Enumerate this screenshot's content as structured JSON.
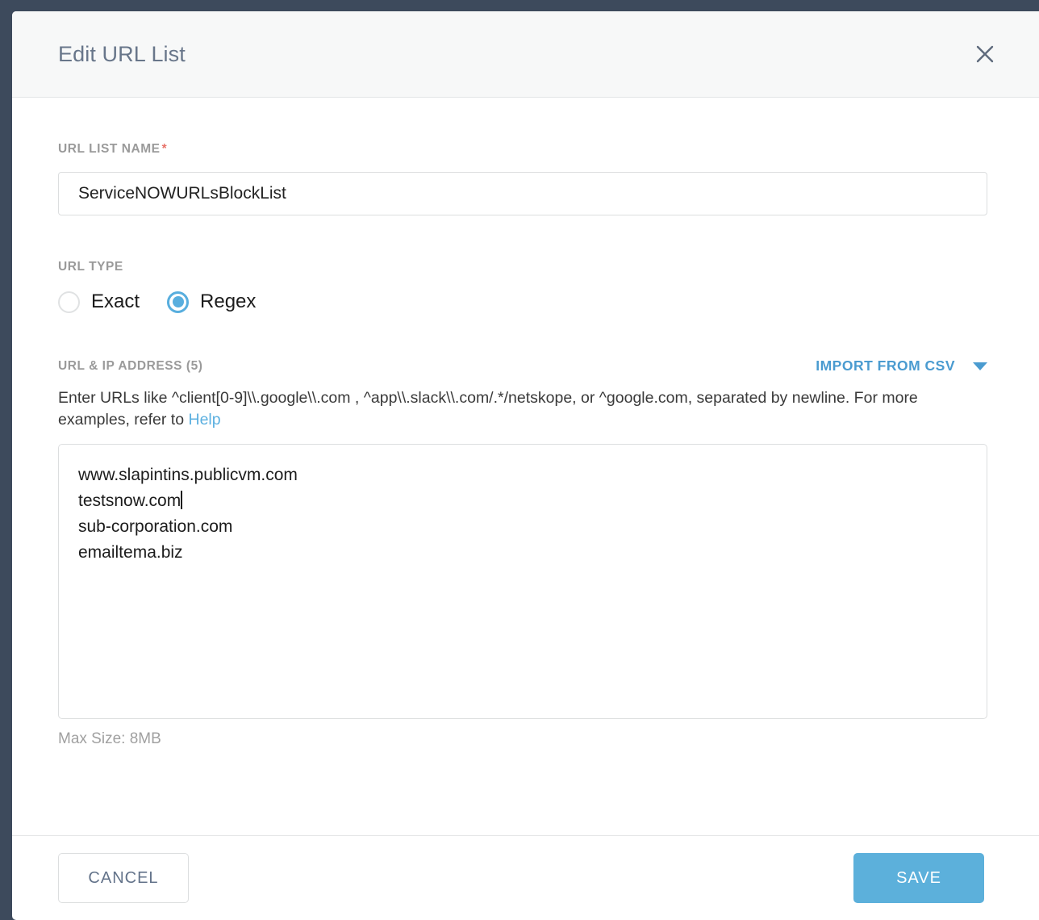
{
  "dialog": {
    "title": "Edit URL List",
    "close_icon": "close-icon"
  },
  "form": {
    "name_label": "URL LIST NAME",
    "required_marker": "*",
    "name_value": "ServiceNOWURLsBlockList",
    "name_placeholder": "",
    "type_label": "URL TYPE",
    "type_options": [
      {
        "label": "Exact",
        "selected": false
      },
      {
        "label": "Regex",
        "selected": true
      }
    ],
    "urlip_label": "URL & IP ADDRESS (5)",
    "import_csv_label": "IMPORT FROM CSV",
    "import_csv_caret": "chevron-down-icon",
    "hint_text": "Enter URLs like ^client[0-9]\\\\.google\\\\.com , ^app\\\\.slack\\\\.com/.*/netskope, or ^google.com, separated by newline. For more examples, refer to ",
    "hint_link": "Help",
    "url_lines": [
      "www.slapintins.publicvm.com",
      "testsnow.com",
      "sub-corporation.com",
      "emailtema.biz"
    ],
    "caret_after_line_index": 1,
    "max_size_text": "Max Size: 8MB"
  },
  "footer": {
    "cancel_label": "CANCEL",
    "save_label": "SAVE"
  },
  "colors": {
    "accent_blue": "#5cb0db",
    "link_blue": "#4a9bd0",
    "title_slate": "#68768a",
    "required_red": "#e8736a",
    "page_backdrop": "#3d4a5c"
  }
}
